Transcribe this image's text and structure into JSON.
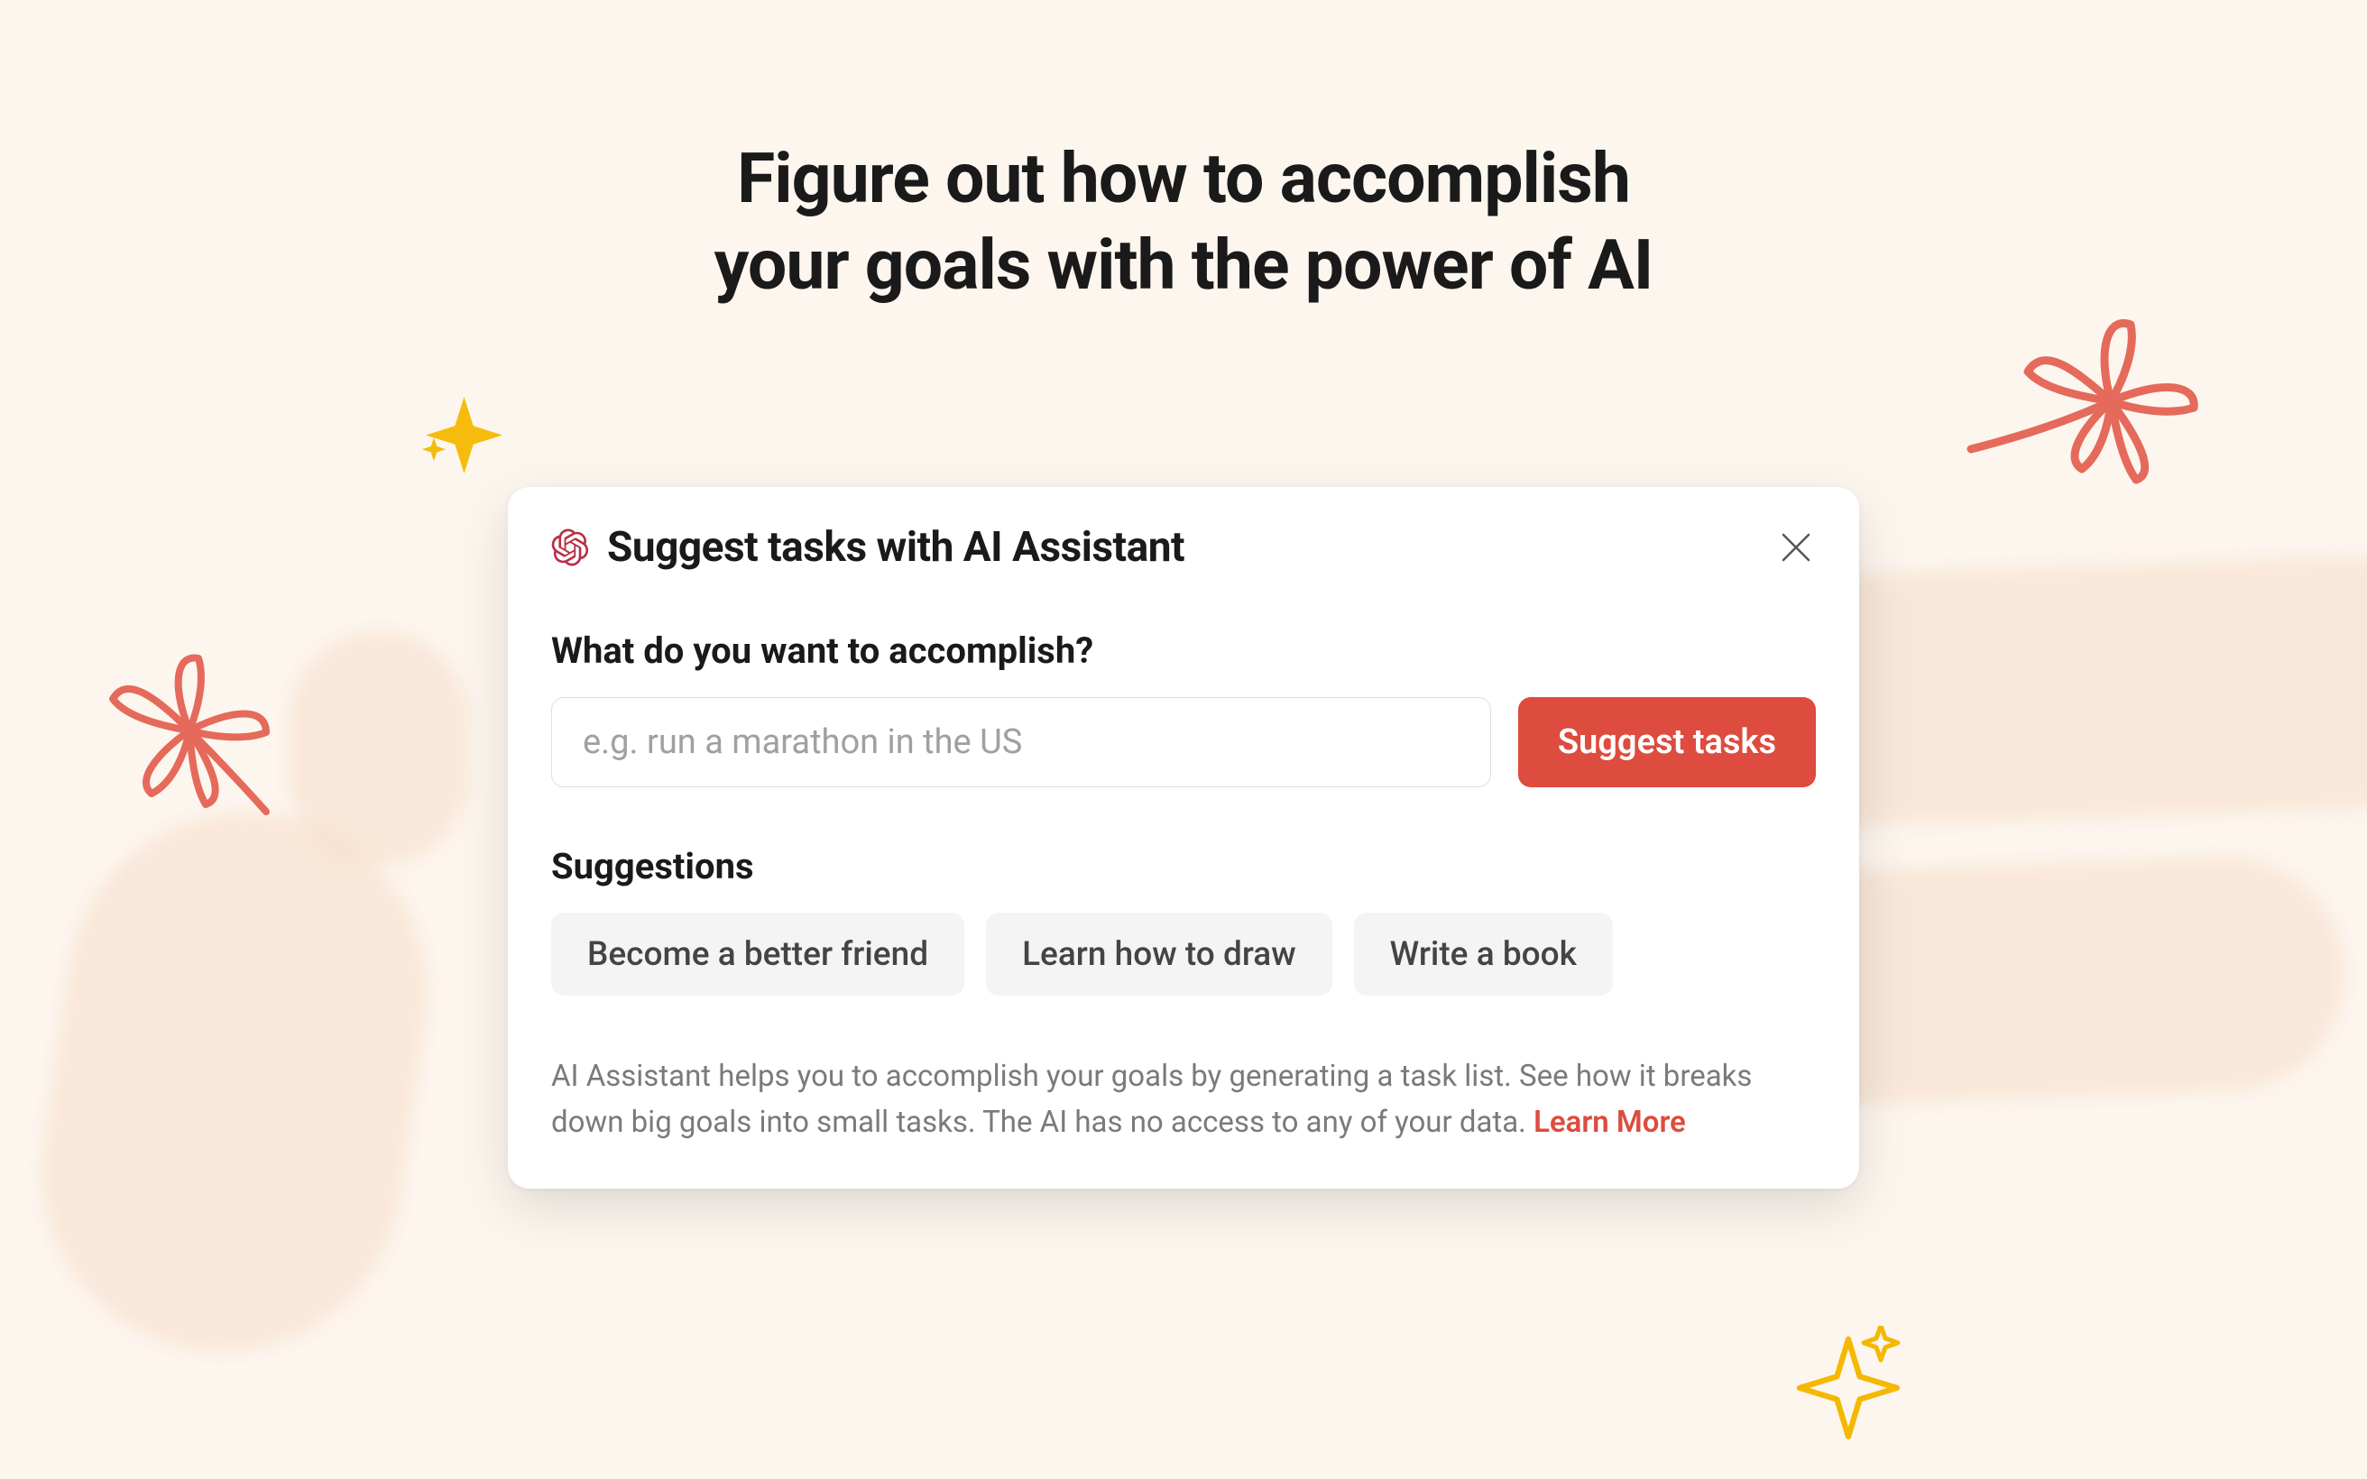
{
  "hero": {
    "heading_line_1": "Figure out how to accomplish",
    "heading_line_2": "your goals with the power of AI"
  },
  "modal": {
    "title": "Suggest tasks with AI Assistant",
    "prompt_label": "What do you want to accomplish?",
    "input_placeholder": "e.g. run a marathon in the US",
    "suggest_button": "Suggest tasks",
    "suggestions_label": "Suggestions",
    "suggestions": [
      "Become a better friend",
      "Learn how to draw",
      "Write a book"
    ],
    "footer_text": "AI Assistant helps you to accomplish your goals by generating a task list. See how it breaks down big goals into small tasks. The AI has no access to any of your data. ",
    "learn_more": "Learn More"
  },
  "colors": {
    "accent": "#dd4c3f",
    "background": "#fdf6ef",
    "chip_bg": "#f4f4f4"
  }
}
